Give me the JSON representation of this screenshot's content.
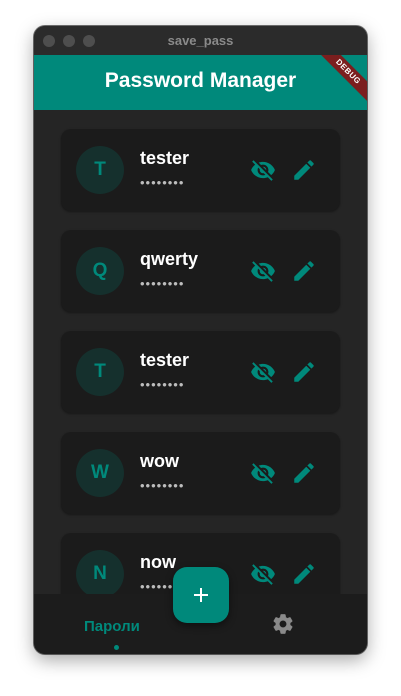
{
  "window": {
    "title": "save_pass"
  },
  "appbar": {
    "title": "Password Manager",
    "debug_label": "DEBUG"
  },
  "entries": [
    {
      "initial": "T",
      "name": "tester",
      "password_masked": "••••••••"
    },
    {
      "initial": "Q",
      "name": "qwerty",
      "password_masked": "••••••••"
    },
    {
      "initial": "T",
      "name": "tester",
      "password_masked": "••••••••"
    },
    {
      "initial": "W",
      "name": "wow",
      "password_masked": "••••••••"
    },
    {
      "initial": "N",
      "name": "now",
      "password_masked": "••••••••"
    }
  ],
  "bottom_nav": {
    "passwords_label": "Пароли",
    "settings_icon": "gear-icon"
  },
  "fab": {
    "icon": "plus-icon"
  },
  "colors": {
    "accent": "#00897b",
    "background": "#252525",
    "card": "#1b1b1b",
    "avatar_bg": "#15302d",
    "debug_banner": "#7b1e1e"
  }
}
